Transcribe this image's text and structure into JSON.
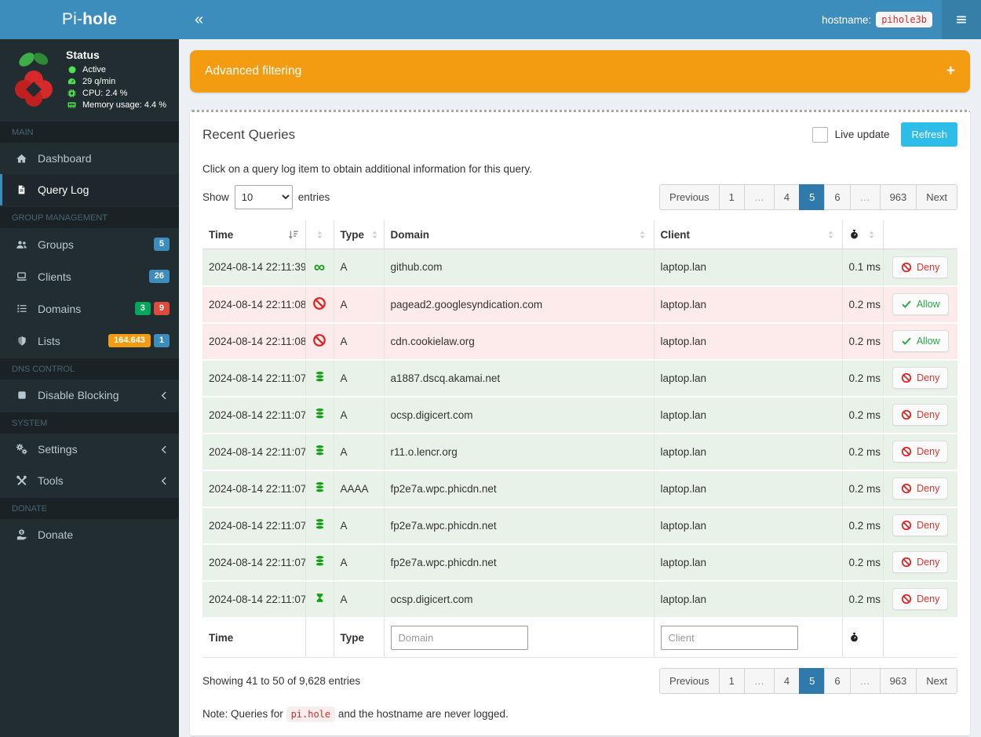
{
  "brand": {
    "pre": "Pi-",
    "bold": "hole"
  },
  "topbar": {
    "collapse_icon": "«",
    "hostname_label": "hostname:",
    "hostname_value": "pihole3b"
  },
  "sidebar": {
    "status": {
      "title": "Status",
      "items": [
        {
          "icon": "circle-icon",
          "label": "Active"
        },
        {
          "icon": "tachometer-icon",
          "label": "29 q/min"
        },
        {
          "icon": "microchip-icon",
          "label": "CPU: 2.4 %"
        },
        {
          "icon": "memory-icon",
          "label": "Memory usage: 4.4 %"
        }
      ]
    },
    "sections": [
      {
        "label": "MAIN",
        "items": [
          {
            "id": "dashboard",
            "icon": "home-icon",
            "label": "Dashboard"
          },
          {
            "id": "query-log",
            "icon": "file-icon",
            "label": "Query Log",
            "active": true
          }
        ]
      },
      {
        "label": "GROUP MANAGEMENT",
        "items": [
          {
            "id": "groups",
            "icon": "users-icon",
            "label": "Groups",
            "badges": [
              {
                "text": "5",
                "color": "blue"
              }
            ]
          },
          {
            "id": "clients",
            "icon": "laptop-icon",
            "label": "Clients",
            "badges": [
              {
                "text": "26",
                "color": "blue"
              }
            ]
          },
          {
            "id": "domains",
            "icon": "list-icon",
            "label": "Domains",
            "badges": [
              {
                "text": "3",
                "color": "green"
              },
              {
                "text": "9",
                "color": "red"
              }
            ]
          },
          {
            "id": "lists",
            "icon": "shield-icon",
            "label": "Lists",
            "badges": [
              {
                "text": "164.643",
                "color": "orange"
              },
              {
                "text": "1",
                "color": "blue"
              }
            ]
          }
        ]
      },
      {
        "label": "DNS CONTROL",
        "items": [
          {
            "id": "disable-blocking",
            "icon": "stop-icon",
            "label": "Disable Blocking",
            "chevron": true
          }
        ]
      },
      {
        "label": "SYSTEM",
        "items": [
          {
            "id": "settings",
            "icon": "gears-icon",
            "label": "Settings",
            "chevron": true
          },
          {
            "id": "tools",
            "icon": "tools-icon",
            "label": "Tools",
            "chevron": true
          }
        ]
      },
      {
        "label": "DONATE",
        "items": [
          {
            "id": "donate",
            "icon": "donate-icon",
            "label": "Donate"
          }
        ]
      }
    ]
  },
  "filtering": {
    "title": "Advanced filtering",
    "expand_icon": "+"
  },
  "queries": {
    "title": "Recent Queries",
    "live_update_label": "Live update",
    "refresh_label": "Refresh",
    "hint": "Click on a query log item to obtain additional information for this query.",
    "show_label": "Show",
    "entries_label": "entries",
    "page_size": "10",
    "pagination": [
      {
        "label": "Previous"
      },
      {
        "label": "1"
      },
      {
        "label": "…",
        "ellipsis": true
      },
      {
        "label": "4"
      },
      {
        "label": "5",
        "active": true
      },
      {
        "label": "6"
      },
      {
        "label": "…",
        "ellipsis": true
      },
      {
        "label": "963"
      },
      {
        "label": "Next"
      }
    ],
    "columns": {
      "time": "Time",
      "type": "Type",
      "domain": "Domain",
      "client": "Client"
    },
    "action_labels": {
      "deny": "Deny",
      "allow": "Allow"
    },
    "rows": [
      {
        "time": "2024-08-14 22:11:39",
        "status_icon": "infinity-icon",
        "type": "A",
        "domain": "github.com",
        "client": "laptop.lan",
        "reply": "0.1 ms",
        "action": "deny",
        "state": "allowed"
      },
      {
        "time": "2024-08-14 22:11:08",
        "status_icon": "ban-icon",
        "type": "A",
        "domain": "pagead2.googlesyndication.com",
        "client": "laptop.lan",
        "reply": "0.2 ms",
        "action": "allow",
        "state": "blocked"
      },
      {
        "time": "2024-08-14 22:11:08",
        "status_icon": "ban-icon",
        "type": "A",
        "domain": "cdn.cookielaw.org",
        "client": "laptop.lan",
        "reply": "0.2 ms",
        "action": "allow",
        "state": "blocked"
      },
      {
        "time": "2024-08-14 22:11:07",
        "status_icon": "database-icon",
        "type": "A",
        "domain": "a1887.dscq.akamai.net",
        "client": "laptop.lan",
        "reply": "0.2 ms",
        "action": "deny",
        "state": "allowed"
      },
      {
        "time": "2024-08-14 22:11:07",
        "status_icon": "database-icon",
        "type": "A",
        "domain": "ocsp.digicert.com",
        "client": "laptop.lan",
        "reply": "0.2 ms",
        "action": "deny",
        "state": "allowed"
      },
      {
        "time": "2024-08-14 22:11:07",
        "status_icon": "database-icon",
        "type": "A",
        "domain": "r11.o.lencr.org",
        "client": "laptop.lan",
        "reply": "0.2 ms",
        "action": "deny",
        "state": "allowed"
      },
      {
        "time": "2024-08-14 22:11:07",
        "status_icon": "database-icon",
        "type": "AAAA",
        "domain": "fp2e7a.wpc.phicdn.net",
        "client": "laptop.lan",
        "reply": "0.2 ms",
        "action": "deny",
        "state": "allowed"
      },
      {
        "time": "2024-08-14 22:11:07",
        "status_icon": "database-icon",
        "type": "A",
        "domain": "fp2e7a.wpc.phicdn.net",
        "client": "laptop.lan",
        "reply": "0.2 ms",
        "action": "deny",
        "state": "allowed"
      },
      {
        "time": "2024-08-14 22:11:07",
        "status_icon": "database-icon",
        "type": "A",
        "domain": "fp2e7a.wpc.phicdn.net",
        "client": "laptop.lan",
        "reply": "0.2 ms",
        "action": "deny",
        "state": "allowed"
      },
      {
        "time": "2024-08-14 22:11:07",
        "status_icon": "hourglass-icon",
        "type": "A",
        "domain": "ocsp.digicert.com",
        "client": "laptop.lan",
        "reply": "0.2 ms",
        "action": "deny",
        "state": "allowed"
      }
    ],
    "footer": {
      "time_label": "Time",
      "type_label": "Type",
      "domain_placeholder": "Domain",
      "client_placeholder": "Client"
    },
    "summary": "Showing 41 to 50 of 9,628 entries",
    "note": {
      "prefix": "Note: Queries for",
      "code": "pi.hole",
      "suffix": "and the hostname are never logged."
    }
  },
  "colors": {
    "header_blue": "#3c8dbc",
    "header_blue_dark": "#367fa9",
    "sidebar_dark": "#222d32",
    "warning_orange": "#f39c12",
    "refresh_cyan": "#2ebde8",
    "pagination_active": "#3079ab",
    "badge_blue": "#3c8dbc",
    "badge_green": "#00a65a",
    "badge_red": "#dd4b39",
    "badge_orange": "#f39c12",
    "allowed_row_bg": "#e9f2e9",
    "blocked_row_bg": "#fdeaea",
    "deny_red": "#d9342b",
    "allow_green": "#28a745",
    "status_icon_green": "#4ce24c",
    "query_icon_green": "#17a017"
  }
}
